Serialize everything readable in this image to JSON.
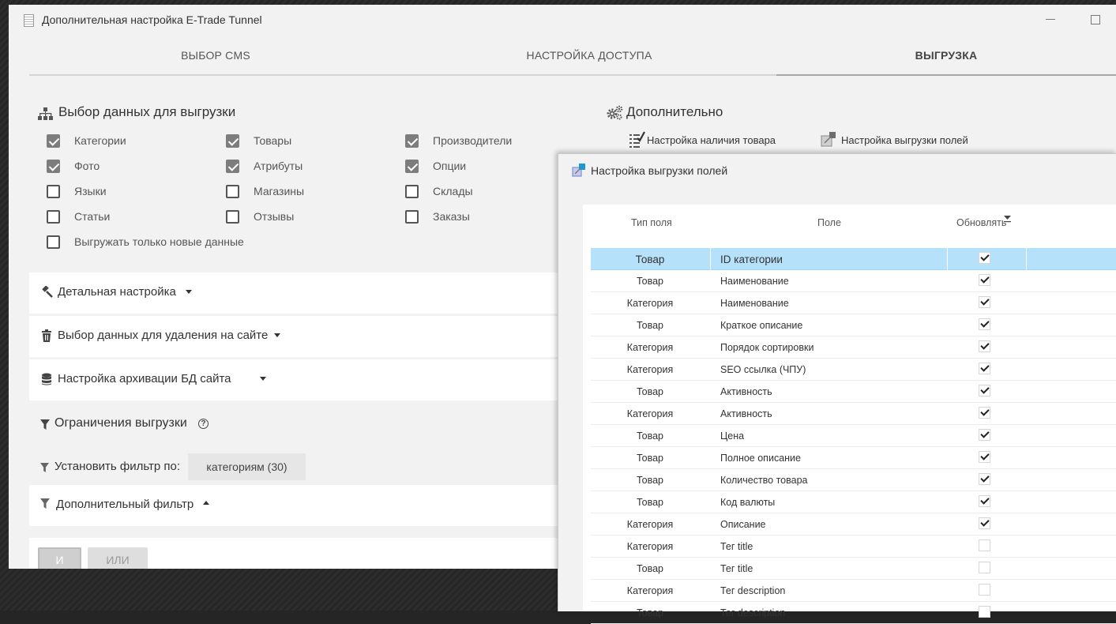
{
  "window": {
    "title": "Дополнительная настройка E-Trade Tunnel"
  },
  "tabs": [
    "ВЫБОР CMS",
    "НАСТРОЙКА ДОСТУПА",
    "ВЫГРУЗКА"
  ],
  "data_selection": {
    "title": "Выбор данных для выгрузки",
    "items": [
      {
        "label": "Категории",
        "checked": true
      },
      {
        "label": "Товары",
        "checked": true
      },
      {
        "label": "Производители",
        "checked": true
      },
      {
        "label": "Фото",
        "checked": true
      },
      {
        "label": "Атрибуты",
        "checked": true
      },
      {
        "label": "Опции",
        "checked": true
      },
      {
        "label": "Языки",
        "checked": false
      },
      {
        "label": "Магазины",
        "checked": false
      },
      {
        "label": "Склады",
        "checked": false
      },
      {
        "label": "Статьи",
        "checked": false
      },
      {
        "label": "Отзывы",
        "checked": false
      },
      {
        "label": "Заказы",
        "checked": false
      }
    ],
    "only_new": {
      "label": "Выгружать только новые данные",
      "checked": false
    }
  },
  "additional": {
    "title": "Дополнительно",
    "stock_link": "Настройка наличия товара",
    "fields_link": "Настройка выгрузки полей"
  },
  "panels": {
    "detailed": "Детальная настройка",
    "delete": "Выбор данных для удаления на сайте",
    "archive": "Настройка архивации БД сайта"
  },
  "limits": {
    "title": "Ограничения выгрузки",
    "help": "?",
    "set_filter_label": "Установить фильтр по:",
    "filter_chip": "категориям (30)",
    "extra_filter": "Дополнительный фильтр",
    "and_label": "И",
    "or_label": "ИЛИ"
  },
  "dialog": {
    "title": "Настройка выгрузки полей",
    "columns": {
      "type": "Тип поля",
      "field": "Поле",
      "update": "Обновлять"
    },
    "rows": [
      {
        "type": "Товар",
        "field": "ID категории",
        "update": true
      },
      {
        "type": "Товар",
        "field": "Наименование",
        "update": true
      },
      {
        "type": "Категория",
        "field": "Наименование",
        "update": true
      },
      {
        "type": "Товар",
        "field": "Краткое описание",
        "update": true
      },
      {
        "type": "Категория",
        "field": "Порядок сортировки",
        "update": true
      },
      {
        "type": "Категория",
        "field": "SEO ссылка (ЧПУ)",
        "update": true
      },
      {
        "type": "Товар",
        "field": "Активность",
        "update": true
      },
      {
        "type": "Категория",
        "field": "Активность",
        "update": true
      },
      {
        "type": "Товар",
        "field": "Цена",
        "update": true
      },
      {
        "type": "Товар",
        "field": "Полное описание",
        "update": true
      },
      {
        "type": "Товар",
        "field": "Количество товара",
        "update": true
      },
      {
        "type": "Товар",
        "field": "Код валюты",
        "update": true
      },
      {
        "type": "Категория",
        "field": "Описание",
        "update": true
      },
      {
        "type": "Категория",
        "field": "Тег title",
        "update": false
      },
      {
        "type": "Товар",
        "field": "Тег title",
        "update": false
      },
      {
        "type": "Категория",
        "field": "Тег description",
        "update": false
      },
      {
        "type": "Товар",
        "field": "Тег description",
        "update": false
      }
    ]
  }
}
